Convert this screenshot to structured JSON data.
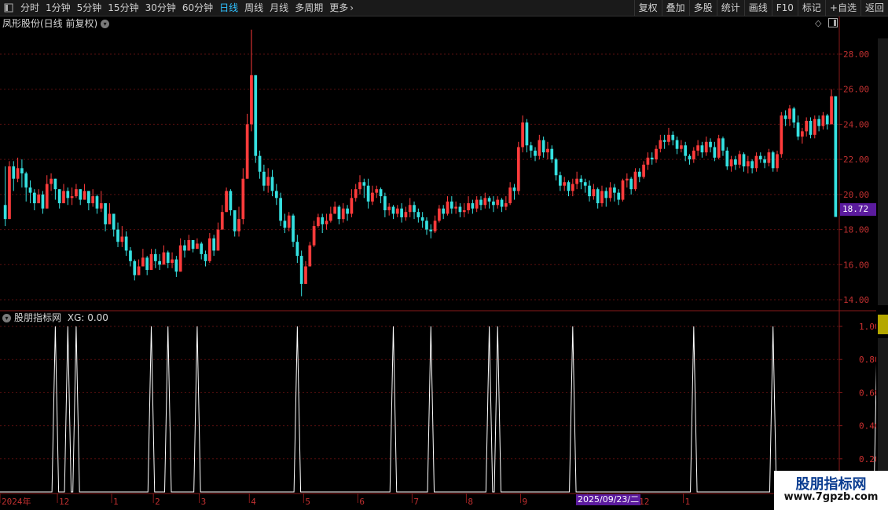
{
  "toolbar": {
    "periods": [
      "分时",
      "1分钟",
      "5分钟",
      "15分钟",
      "30分钟",
      "60分钟",
      "日线",
      "周线",
      "月线",
      "多周期",
      "更多"
    ],
    "active_period": "日线",
    "right_buttons": [
      "复权",
      "叠加",
      "多股",
      "统计",
      "画线",
      "F10",
      "标记",
      "+自选",
      "返回"
    ]
  },
  "main_panel": {
    "title": "凤形股份(日线 前复权)",
    "current_price_tag": "18.72",
    "y_labels": [
      "28.00",
      "26.00",
      "24.00",
      "22.00",
      "20.00",
      "18.00",
      "16.00",
      "14.00"
    ]
  },
  "indicator_panel": {
    "title": "股朋指标网",
    "readout": "XG: 0.00",
    "y_labels": [
      "1.00",
      "0.80",
      "0.60",
      "0.40",
      "0.20"
    ]
  },
  "x_axis": {
    "labels": [
      "2024年",
      "12",
      "1",
      "2",
      "3",
      "4",
      "5",
      "6",
      "7",
      "8",
      "9",
      "1",
      "12",
      "1"
    ],
    "cursor_date": "2025/09/23/二"
  },
  "watermark": {
    "line1": "股朋指标网",
    "line2": "www.7gpzb.com"
  },
  "colors": {
    "up": "#ff3b3b",
    "down": "#35e0e0",
    "grid": "#5a0f0f",
    "axis": "#8a1a1a",
    "signal": "#ffffff"
  },
  "chart_data": [
    {
      "type": "candlestick",
      "title": "凤形股份(日线 前复权)",
      "ylim": [
        13.5,
        29.5
      ],
      "yticks": [
        14,
        16,
        18,
        20,
        22,
        24,
        26,
        28
      ],
      "grid": true,
      "closes": [
        18.6,
        21.6,
        20.9,
        21.5,
        21.2,
        20.4,
        20.1,
        19.5,
        20.0,
        19.2,
        20.6,
        20.9,
        20.3,
        19.5,
        20.2,
        19.8,
        19.9,
        20.3,
        19.7,
        20.2,
        19.5,
        19.9,
        19.2,
        19.5,
        18.3,
        18.9,
        18.0,
        17.3,
        17.6,
        16.8,
        16.2,
        15.4,
        15.9,
        16.4,
        15.7,
        16.6,
        16.2,
        16.0,
        16.7,
        16.1,
        16.3,
        15.6,
        17.1,
        16.8,
        17.4,
        16.9,
        17.2,
        16.6,
        16.2,
        17.5,
        16.8,
        18.0,
        19.0,
        20.2,
        19.1,
        17.9,
        18.6,
        20.9,
        24.0,
        26.8,
        22.2,
        21.3,
        20.5,
        21.0,
        20.2,
        19.8,
        18.5,
        18.1,
        18.8,
        17.3,
        16.5,
        14.9,
        15.9,
        17.1,
        18.2,
        18.7,
        18.3,
        18.5,
        18.9,
        19.3,
        18.6,
        19.2,
        18.9,
        19.8,
        20.3,
        20.7,
        20.5,
        19.6,
        20.1,
        20.3,
        19.9,
        19.1,
        19.3,
        18.9,
        19.2,
        18.7,
        19.0,
        19.4,
        19.0,
        18.7,
        18.5,
        18.0,
        17.9,
        18.5,
        19.2,
        18.9,
        19.6,
        19.2,
        19.3,
        19.0,
        19.1,
        19.5,
        19.2,
        19.7,
        19.4,
        19.8,
        19.6,
        19.4,
        19.7,
        19.3,
        19.5,
        20.4,
        20.2,
        22.7,
        24.1,
        22.8,
        22.5,
        22.2,
        23.1,
        22.4,
        22.6,
        22.0,
        21.1,
        20.5,
        20.7,
        20.2,
        20.6,
        20.9,
        20.7,
        20.5,
        19.9,
        20.3,
        19.5,
        20.2,
        19.8,
        20.4,
        20.1,
        19.7,
        20.8,
        20.9,
        20.3,
        21.3,
        21.0,
        21.7,
        22.1,
        22.0,
        22.6,
        23.1,
        23.0,
        23.4,
        23.1,
        22.6,
        22.8,
        22.2,
        22.0,
        22.5,
        22.8,
        22.4,
        23.0,
        22.7,
        22.1,
        23.2,
        22.5,
        21.6,
        22.0,
        21.7,
        22.3,
        21.6,
        21.9,
        21.5,
        22.2,
        22.0,
        21.8,
        22.4,
        21.5,
        22.3,
        24.5,
        24.3,
        24.9,
        24.1,
        23.3,
        23.6,
        24.2,
        23.4,
        24.3,
        23.9,
        24.5,
        24.0,
        25.6,
        18.72
      ],
      "series": [
        {
          "values": [
            21.6,
            21.9,
            21.9,
            22.1,
            22.0,
            21.3,
            20.8,
            20.3,
            20.3,
            20.2,
            21.1,
            21.2,
            20.9,
            20.1,
            20.6,
            20.4,
            20.4,
            20.6,
            20.3,
            20.6,
            20.2,
            20.3,
            20.0,
            20.2,
            19.4,
            19.5,
            18.8,
            18.4,
            18.2,
            17.9,
            17.0,
            16.3,
            16.3,
            16.9,
            16.5,
            16.9,
            16.9,
            16.6,
            17.1,
            16.8,
            16.7,
            16.5,
            17.5,
            17.4,
            17.7,
            17.4,
            17.5,
            17.3,
            16.8,
            17.8,
            17.7,
            18.4,
            19.4,
            20.4,
            20.3,
            19.0,
            19.3,
            21.5,
            24.6,
            29.4,
            26.7,
            22.5,
            21.7,
            21.5,
            21.4,
            20.6,
            20.1,
            18.9,
            19.0,
            18.9,
            17.7,
            16.8,
            16.2,
            17.3,
            18.5,
            18.9,
            18.9,
            18.9,
            19.3,
            19.6,
            19.4,
            19.5,
            19.4,
            20.3,
            20.6,
            21.1,
            20.9,
            20.9,
            20.5,
            20.5,
            20.4,
            20.1,
            19.5,
            19.4,
            19.4,
            19.5,
            19.3,
            19.8,
            19.6,
            19.2,
            19.0,
            18.7,
            18.3,
            18.8,
            19.4,
            19.4,
            19.9,
            19.9,
            19.6,
            19.5,
            19.5,
            19.9,
            19.7,
            19.9,
            19.9,
            20.1,
            19.9,
            19.9,
            19.9,
            19.8,
            19.9,
            20.7,
            20.6,
            23.0,
            24.5,
            24.3,
            23.0,
            22.7,
            23.4,
            23.3,
            23.0,
            22.8,
            22.1,
            21.3,
            21.0,
            20.8,
            20.9,
            21.3,
            21.1,
            20.9,
            20.8,
            20.6,
            20.4,
            20.5,
            20.4,
            20.7,
            20.6,
            20.3,
            20.9,
            21.2,
            21.0,
            21.5,
            21.5,
            21.9,
            22.4,
            22.4,
            22.8,
            23.4,
            23.4,
            23.8,
            23.6,
            23.3,
            23.1,
            23.0,
            22.3,
            22.7,
            23.1,
            23.0,
            23.3,
            23.2,
            23.0,
            23.4,
            23.3,
            22.7,
            22.2,
            22.2,
            22.5,
            22.4,
            22.2,
            22.0,
            22.4,
            22.4,
            22.2,
            22.6,
            22.5,
            22.5,
            24.7,
            24.8,
            25.1,
            25.0,
            24.5,
            23.8,
            24.4,
            24.4,
            24.5,
            24.5,
            24.7,
            24.6,
            26.0,
            18.72
          ]
        },
        {
          "values": [
            18.2,
            20.8,
            20.2,
            20.7,
            20.4,
            19.6,
            19.5,
            19.1,
            19.5,
            18.9,
            20.1,
            20.2,
            19.7,
            19.2,
            19.8,
            19.4,
            19.4,
            19.8,
            19.4,
            19.8,
            19.1,
            19.3,
            18.9,
            19.0,
            17.9,
            18.4,
            17.6,
            17.0,
            17.0,
            16.5,
            15.9,
            15.1,
            15.4,
            15.9,
            15.4,
            15.9,
            15.8,
            15.7,
            16.1,
            15.8,
            15.8,
            15.3,
            16.6,
            16.4,
            16.8,
            16.7,
            16.9,
            16.3,
            15.9,
            16.1,
            16.5,
            17.2,
            18.2,
            19.2,
            18.8,
            17.6,
            17.6,
            18.3,
            21.0,
            23.6,
            21.8,
            20.9,
            20.2,
            20.1,
            19.9,
            19.4,
            18.2,
            17.8,
            17.9,
            17.0,
            16.1,
            14.2,
            15.2,
            16.0,
            17.0,
            18.1,
            17.8,
            18.0,
            18.4,
            18.9,
            18.3,
            18.4,
            18.5,
            18.7,
            19.6,
            20.0,
            19.8,
            19.2,
            19.4,
            19.8,
            19.5,
            18.7,
            18.8,
            18.6,
            18.7,
            18.4,
            18.5,
            18.7,
            18.6,
            18.4,
            18.1,
            17.7,
            17.5,
            17.8,
            18.4,
            18.6,
            18.8,
            18.9,
            18.9,
            18.7,
            18.7,
            18.9,
            18.9,
            19.0,
            19.1,
            19.2,
            19.2,
            19.0,
            19.2,
            19.0,
            19.1,
            19.4,
            19.7,
            20.0,
            22.4,
            22.4,
            22.1,
            21.9,
            22.0,
            22.1,
            22.0,
            21.8,
            20.8,
            20.2,
            20.2,
            19.9,
            19.9,
            20.3,
            20.3,
            20.1,
            19.6,
            19.7,
            19.2,
            19.3,
            19.3,
            19.6,
            19.6,
            19.4,
            19.6,
            20.4,
            20.0,
            20.2,
            20.7,
            20.9,
            21.4,
            21.7,
            21.8,
            22.4,
            22.6,
            22.8,
            22.8,
            22.3,
            22.4,
            21.9,
            21.7,
            21.8,
            22.2,
            22.1,
            22.2,
            22.4,
            21.9,
            22.0,
            22.2,
            21.4,
            21.3,
            21.4,
            21.5,
            21.3,
            21.2,
            21.2,
            21.3,
            21.8,
            21.5,
            21.6,
            21.3,
            21.3,
            22.1,
            23.9,
            23.9,
            23.8,
            23.1,
            22.9,
            23.3,
            23.2,
            23.2,
            23.6,
            23.7,
            23.7,
            24.0,
            18.72
          ]
        }
      ]
    },
    {
      "type": "bar",
      "title": "股朋指标网",
      "series": [
        {
          "name": "XG",
          "values": [
            12,
            15,
            17,
            35,
            39,
            46,
            70,
            93,
            102,
            116,
            118,
            136,
            165,
            184,
            209,
            216
          ]
        }
      ],
      "ylim": [
        0,
        1.05
      ],
      "yticks": [
        0.2,
        0.4,
        0.6,
        0.8,
        1.0
      ]
    }
  ]
}
